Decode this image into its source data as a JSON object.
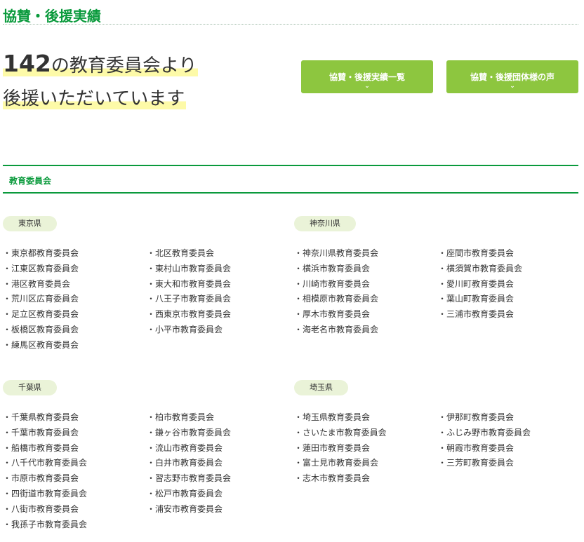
{
  "page": {
    "title": "協賛・後援実績",
    "headline_count": "142",
    "headline_line1": "の教育委員会より",
    "headline_line2": "後援いただいています"
  },
  "buttons": {
    "list": "協賛・後援実績一覧",
    "voices": "協賛・後援団体様の声",
    "chevron": "⌄"
  },
  "section": {
    "title": "教育委員会"
  },
  "prefectures": {
    "tokyo": {
      "name": "東京県",
      "col1": [
        "東京都教育委員会",
        "江東区教育委員会",
        "港区教育委員会",
        "荒川区広育委員会",
        "足立区教育委員会",
        "板橋区教育委員会",
        "練馬区教育委員会"
      ],
      "col2": [
        "北区教育委員会",
        "東村山市教育委員会",
        "東大和市教育委員会",
        "八王子市教育委員会",
        "西東京市教育委員会",
        "小平市教育委員会"
      ]
    },
    "kanagawa": {
      "name": "神奈川県",
      "col1": [
        "神奈川県教育委員会",
        "横浜市教育委員会",
        "川崎市教育委員会",
        "相模原市教育委員会",
        "厚木市教育委員会",
        "海老名市教育委員会"
      ],
      "col2": [
        "座間市教育委員会",
        "横須賀市教育委員会",
        "愛川町教育委員会",
        "葉山町教育委員会",
        "三浦市教育委員会"
      ]
    },
    "chiba": {
      "name": "千葉県",
      "col1": [
        "千葉県教育委員会",
        "千葉市教育委員会",
        "船橋市教育委員会",
        "八千代市教育委員会",
        "市原市教育委員会",
        "四街道市教育委員会",
        "八街市教育委員会",
        "我孫子市教育委員会"
      ],
      "col2": [
        "柏市教育委員会",
        "鎌ヶ谷市教育委員会",
        "流山市教育委員会",
        "白井市教育委員会",
        "習志野市教育委員会",
        "松戸市教育委員会",
        "浦安市教育委員会"
      ]
    },
    "saitama": {
      "name": "埼玉県",
      "col1": [
        "埼玉県教育委員会",
        "さいたま市教育委員会",
        "蓮田市教育委員会",
        "富士見市教育委員会",
        "志木市教育委員会"
      ],
      "col2": [
        "伊那町教育委員会",
        "ふじみ野市教育委員会",
        "朝霞市教育委員会",
        "三芳町教育委員会"
      ]
    }
  }
}
